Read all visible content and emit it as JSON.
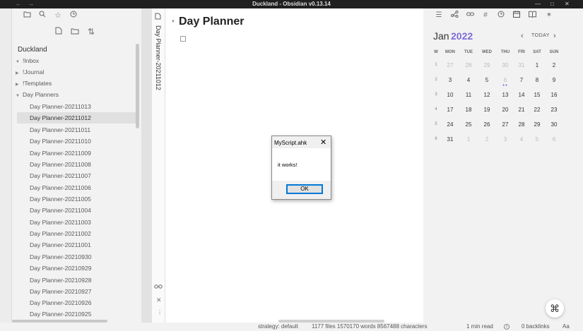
{
  "window": {
    "title": "Duckland - Obsidian v0.13.14",
    "nav_back": "←",
    "nav_forward": "→",
    "minimize": "—",
    "maximize": "□",
    "close": "✕"
  },
  "left_sidebar": {
    "vault_name": "Duckland",
    "folders": [
      {
        "name": "!Inbox",
        "expanded": true
      },
      {
        "name": "!Journal",
        "expanded": false
      },
      {
        "name": "!Templates",
        "expanded": false
      },
      {
        "name": "Day Planners",
        "expanded": true
      }
    ],
    "files": [
      "Day Planner-20211013",
      "Day Planner-20211012",
      "Day Planner-20211011",
      "Day Planner-20211010",
      "Day Planner-20211009",
      "Day Planner-20211008",
      "Day Planner-20211007",
      "Day Planner-20211006",
      "Day Planner-20211005",
      "Day Planner-20211004",
      "Day Planner-20211003",
      "Day Planner-20211002",
      "Day Planner-20211001",
      "Day Planner-20210930",
      "Day Planner-20210929",
      "Day Planner-20210928",
      "Day Planner-20210927",
      "Day Planner-20210926",
      "Day Planner-20210925"
    ],
    "active_file": "Day Planner-20211012"
  },
  "collapsed_pane": {
    "title": "Day Planner-20211012"
  },
  "editor": {
    "heading": "Day Planner",
    "task_checked": false
  },
  "calendar": {
    "month": "Jan",
    "year": "2022",
    "today_label": "TODAY",
    "headers": [
      "W",
      "MON",
      "TUE",
      "WED",
      "THU",
      "FRI",
      "SAT",
      "SUN"
    ],
    "weeks": [
      {
        "week": "1",
        "days": [
          "27",
          "28",
          "29",
          "30",
          "31",
          "1",
          "2"
        ],
        "other": [
          true,
          true,
          true,
          true,
          true,
          false,
          false
        ]
      },
      {
        "week": "2",
        "days": [
          "3",
          "4",
          "5",
          "6",
          "7",
          "8",
          "9"
        ],
        "other": [
          false,
          false,
          false,
          true,
          false,
          false,
          false
        ]
      },
      {
        "week": "3",
        "days": [
          "10",
          "11",
          "12",
          "13",
          "14",
          "15",
          "16"
        ],
        "other": [
          false,
          false,
          false,
          false,
          false,
          false,
          false
        ]
      },
      {
        "week": "4",
        "days": [
          "17",
          "18",
          "19",
          "20",
          "21",
          "22",
          "23"
        ],
        "other": [
          false,
          false,
          false,
          false,
          false,
          false,
          false
        ]
      },
      {
        "week": "5",
        "days": [
          "24",
          "25",
          "26",
          "27",
          "28",
          "29",
          "30"
        ],
        "other": [
          false,
          false,
          false,
          false,
          false,
          false,
          false
        ]
      },
      {
        "week": "6",
        "days": [
          "31",
          "1",
          "2",
          "3",
          "4",
          "5",
          "6"
        ],
        "other": [
          false,
          true,
          true,
          true,
          true,
          true,
          true
        ]
      }
    ],
    "accent_color": "#7b6cd9"
  },
  "status_bar": {
    "strategy": "strategy: default",
    "stats": "1177 files 1570170 words 8567488 characters",
    "read_time": "1 min read",
    "backlinks": "0 backlinks",
    "font_toggle": "Aa"
  },
  "dialog": {
    "title": "MyScript.ahk",
    "message": "it works!",
    "ok_label": "OK",
    "close_glyph": "✕"
  },
  "command_button": {
    "glyph": "⌘"
  }
}
